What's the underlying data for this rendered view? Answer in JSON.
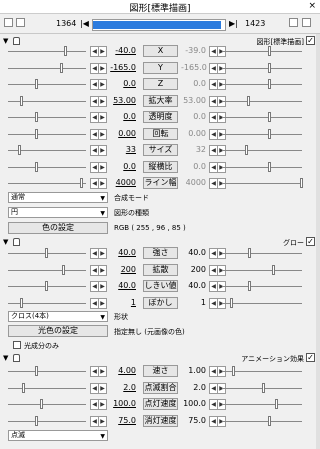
{
  "window": {
    "title": "図形[標準描画]",
    "close": "×"
  },
  "frame": {
    "start": "1364",
    "end": "1423",
    "nav_left": "|◀",
    "nav_right": "▶|"
  },
  "sections": {
    "standard": {
      "label": "図形[標準描画]"
    },
    "glow": {
      "label": "グロー"
    },
    "anim": {
      "label": "アニメーション効果"
    }
  },
  "std_rows": [
    {
      "left": "-40.0",
      "label": "X",
      "right": "-39.0"
    },
    {
      "left": "-165.0",
      "label": "Y",
      "right": "-165.0"
    },
    {
      "left": "0.0",
      "label": "Z",
      "right": "0.0"
    },
    {
      "left": "53.00",
      "label": "拡大率",
      "right": "53.00"
    },
    {
      "left": "0.0",
      "label": "透明度",
      "right": "0.0"
    },
    {
      "left": "0.00",
      "label": "回転",
      "right": "0.00"
    },
    {
      "left": "33",
      "label": "サイズ",
      "right": "32"
    },
    {
      "left": "0.0",
      "label": "縦横比",
      "right": "0.0"
    },
    {
      "left": "4000",
      "label": "ライン幅",
      "right": "4000"
    }
  ],
  "blend": {
    "value": "通常",
    "label": "合成モード"
  },
  "shape": {
    "value": "円",
    "label": "図形の種類"
  },
  "color": {
    "button": "色の設定",
    "rgb": "RGB ( 255 , 96 , 85 )"
  },
  "glow_rows": [
    {
      "left": "40.0",
      "label": "強さ",
      "right": "40.0"
    },
    {
      "left": "200",
      "label": "拡散",
      "right": "200"
    },
    {
      "left": "40.0",
      "label": "しきい値",
      "right": "40.0"
    },
    {
      "left": "1",
      "label": "ぼかし",
      "right": "1"
    }
  ],
  "glow_shape": {
    "value": "クロス(4本)",
    "label": "形状"
  },
  "glow_color": {
    "button": "光色の設定",
    "text": "指定無し (元画像の色)"
  },
  "glow_only": {
    "label": "光成分のみ"
  },
  "anim_rows": [
    {
      "left": "4.00",
      "label": "速さ",
      "right": "1.00"
    },
    {
      "left": "2.0",
      "label": "点滅割合",
      "right": "2.0"
    },
    {
      "left": "100.0",
      "label": "点灯速度",
      "right": "100.0"
    },
    {
      "left": "75.0",
      "label": "消灯速度",
      "right": "75.0"
    }
  ],
  "anim_type": {
    "value": "点滅"
  }
}
